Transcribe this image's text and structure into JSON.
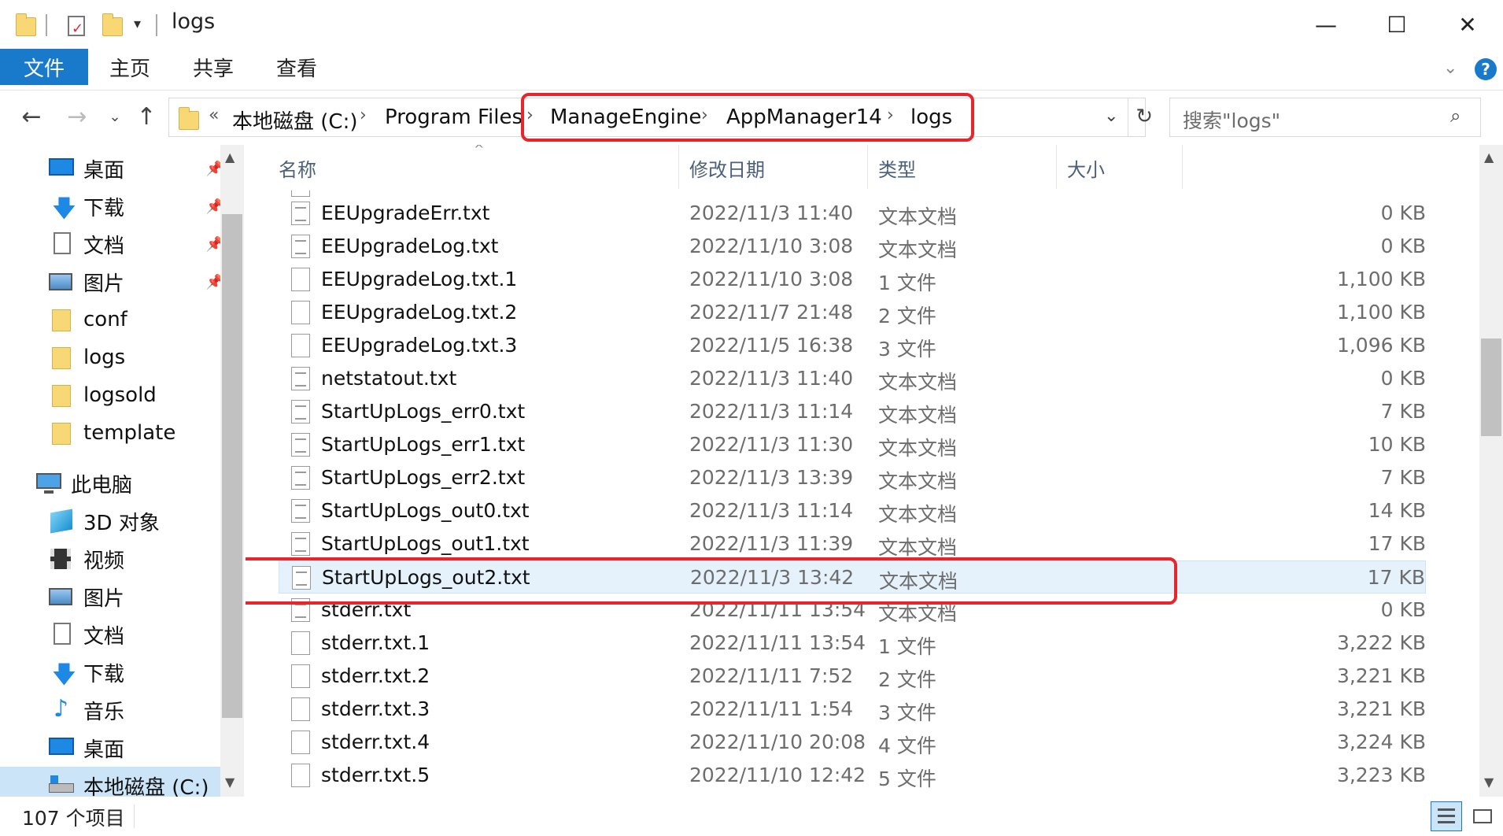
{
  "window": {
    "title": "logs",
    "minimize_glyph": "—",
    "maximize_glyph": "☐",
    "close_glyph": "✕"
  },
  "ribbon": {
    "tabs": [
      "文件",
      "主页",
      "共享",
      "查看"
    ],
    "accent": "#1979ca"
  },
  "address": {
    "prefix": "«",
    "crumbs": [
      "本地磁盘 (C:)",
      "Program Files",
      "ManageEngine",
      "AppManager14",
      "logs"
    ],
    "separator": "›",
    "search_placeholder": "搜索\"logs\""
  },
  "nav": {
    "quick_access": [
      {
        "label": "桌面",
        "icon": "desktop-icon",
        "pinned": true
      },
      {
        "label": "下载",
        "icon": "download-icon",
        "pinned": true
      },
      {
        "label": "文档",
        "icon": "document-icon",
        "pinned": true
      },
      {
        "label": "图片",
        "icon": "picture-icon",
        "pinned": true
      },
      {
        "label": "conf",
        "icon": "folder-icon",
        "pinned": false
      },
      {
        "label": "logs",
        "icon": "folder-icon",
        "pinned": false
      },
      {
        "label": "logsold",
        "icon": "folder-icon",
        "pinned": false
      },
      {
        "label": "template",
        "icon": "folder-icon",
        "pinned": false
      }
    ],
    "this_pc_label": "此电脑",
    "this_pc": [
      {
        "label": "3D 对象",
        "icon": "3d-objects-icon"
      },
      {
        "label": "视频",
        "icon": "video-icon"
      },
      {
        "label": "图片",
        "icon": "picture-icon"
      },
      {
        "label": "文档",
        "icon": "document-icon"
      },
      {
        "label": "下载",
        "icon": "download-icon"
      },
      {
        "label": "音乐",
        "icon": "music-icon"
      },
      {
        "label": "桌面",
        "icon": "desktop-icon"
      },
      {
        "label": "本地磁盘 (C:)",
        "icon": "drive-icon",
        "selected": true
      }
    ]
  },
  "columns": {
    "name": "名称",
    "date": "修改日期",
    "type": "类型",
    "size": "大小"
  },
  "files": [
    {
      "name": "EEUpgradeErr.txt",
      "date": "2022/11/3 11:40",
      "type": "文本文档",
      "size": "0 KB",
      "icon": "text-file-icon"
    },
    {
      "name": "EEUpgradeLog.txt",
      "date": "2022/11/10 3:08",
      "type": "文本文档",
      "size": "0 KB",
      "icon": "text-file-icon"
    },
    {
      "name": "EEUpgradeLog.txt.1",
      "date": "2022/11/10 3:08",
      "type": "1 文件",
      "size": "1,100 KB",
      "icon": "file-icon"
    },
    {
      "name": "EEUpgradeLog.txt.2",
      "date": "2022/11/7 21:48",
      "type": "2 文件",
      "size": "1,100 KB",
      "icon": "file-icon"
    },
    {
      "name": "EEUpgradeLog.txt.3",
      "date": "2022/11/5 16:38",
      "type": "3 文件",
      "size": "1,096 KB",
      "icon": "file-icon"
    },
    {
      "name": "netstatout.txt",
      "date": "2022/11/3 11:40",
      "type": "文本文档",
      "size": "0 KB",
      "icon": "text-file-icon"
    },
    {
      "name": "StartUpLogs_err0.txt",
      "date": "2022/11/3 11:14",
      "type": "文本文档",
      "size": "7 KB",
      "icon": "text-file-icon"
    },
    {
      "name": "StartUpLogs_err1.txt",
      "date": "2022/11/3 11:30",
      "type": "文本文档",
      "size": "10 KB",
      "icon": "text-file-icon"
    },
    {
      "name": "StartUpLogs_err2.txt",
      "date": "2022/11/3 13:39",
      "type": "文本文档",
      "size": "7 KB",
      "icon": "text-file-icon"
    },
    {
      "name": "StartUpLogs_out0.txt",
      "date": "2022/11/3 11:14",
      "type": "文本文档",
      "size": "14 KB",
      "icon": "text-file-icon"
    },
    {
      "name": "StartUpLogs_out1.txt",
      "date": "2022/11/3 11:39",
      "type": "文本文档",
      "size": "17 KB",
      "icon": "text-file-icon"
    },
    {
      "name": "StartUpLogs_out2.txt",
      "date": "2022/11/3 13:42",
      "type": "文本文档",
      "size": "17 KB",
      "icon": "text-file-icon",
      "selected": true
    },
    {
      "name": "stderr.txt",
      "date": "2022/11/11 13:54",
      "type": "文本文档",
      "size": "0 KB",
      "icon": "text-file-icon"
    },
    {
      "name": "stderr.txt.1",
      "date": "2022/11/11 13:54",
      "type": "1 文件",
      "size": "3,222 KB",
      "icon": "file-icon"
    },
    {
      "name": "stderr.txt.2",
      "date": "2022/11/11 7:52",
      "type": "2 文件",
      "size": "3,221 KB",
      "icon": "file-icon"
    },
    {
      "name": "stderr.txt.3",
      "date": "2022/11/11 1:54",
      "type": "3 文件",
      "size": "3,221 KB",
      "icon": "file-icon"
    },
    {
      "name": "stderr.txt.4",
      "date": "2022/11/10 20:08",
      "type": "4 文件",
      "size": "3,224 KB",
      "icon": "file-icon"
    },
    {
      "name": "stderr.txt.5",
      "date": "2022/11/10 12:42",
      "type": "5 文件",
      "size": "3,223 KB",
      "icon": "file-icon"
    }
  ],
  "status": {
    "item_count": "107 个项目"
  },
  "highlight_color": "#e8252b"
}
